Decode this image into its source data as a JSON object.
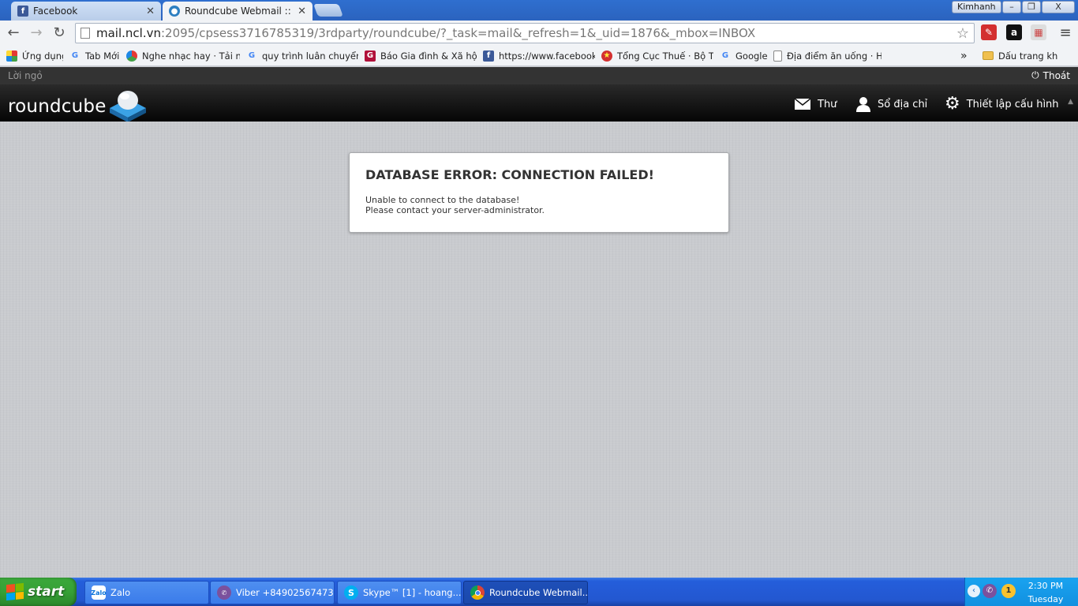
{
  "browser": {
    "tabs": [
      {
        "title": "Facebook",
        "icon": "facebook-icon",
        "active": false
      },
      {
        "title": "Roundcube Webmail ::",
        "icon": "roundcube-icon",
        "active": true
      }
    ],
    "profile": "Kimhanh",
    "window_controls": {
      "minimize": "–",
      "restore": "❐",
      "close": "X"
    },
    "url_host": "mail.ncl.vn",
    "url_rest": ":2095/cpsess3716785319/3rdparty/roundcube/?_task=mail&_refresh=1&_uid=1876&_mbox=INBOX",
    "bookmarks": [
      {
        "label": "Ứng dụng",
        "icon": "apps-grid-icon"
      },
      {
        "label": "Tab Mới",
        "icon": "google-icon"
      },
      {
        "label": "Nghe nhạc hay · Tải nhạc",
        "icon": "music-site-icon"
      },
      {
        "label": "quy trình luân chuyển ch",
        "icon": "google-icon"
      },
      {
        "label": "Báo Gia đình & Xã hội | ",
        "icon": "giadinh-icon"
      },
      {
        "label": "https://www.facebook.c",
        "icon": "facebook-icon"
      },
      {
        "label": "Tổng Cục Thuế · Bộ Tài",
        "icon": "tax-office-icon"
      },
      {
        "label": "Google",
        "icon": "google-icon"
      },
      {
        "label": "Địa điểm ăn uống · Hom",
        "icon": "page-icon"
      }
    ],
    "bookmarks_overflow": "»",
    "other_bookmarks": "Dấu trang khác"
  },
  "roundcube": {
    "greeting": "Lời ngỏ",
    "logout": "Thoát",
    "logo": "roundcube",
    "nav": {
      "mail": "Thư",
      "contacts": "Sổ địa chỉ",
      "settings": "Thiết lập cấu hình"
    },
    "error": {
      "title": "DATABASE ERROR: CONNECTION FAILED!",
      "line1": "Unable to connect to the database!",
      "line2": "Please contact your server-administrator."
    }
  },
  "taskbar": {
    "start": "start",
    "items": [
      {
        "label": "Zalo",
        "icon": "zalo-icon",
        "active": false
      },
      {
        "label": "Viber +84902567473",
        "icon": "viber-icon",
        "active": false
      },
      {
        "label": "Skype™ [1] - hoang...",
        "icon": "skype-icon",
        "active": false
      },
      {
        "label": "Roundcube Webmail...",
        "icon": "chrome-icon",
        "active": true
      }
    ],
    "tray_badge": "1",
    "time": "2:30 PM",
    "day": "Tuesday"
  },
  "colors": {
    "accent_blue": "#245edb",
    "start_green": "#36a136",
    "header_black": "#050505",
    "background_gray": "#c9cbcf"
  }
}
